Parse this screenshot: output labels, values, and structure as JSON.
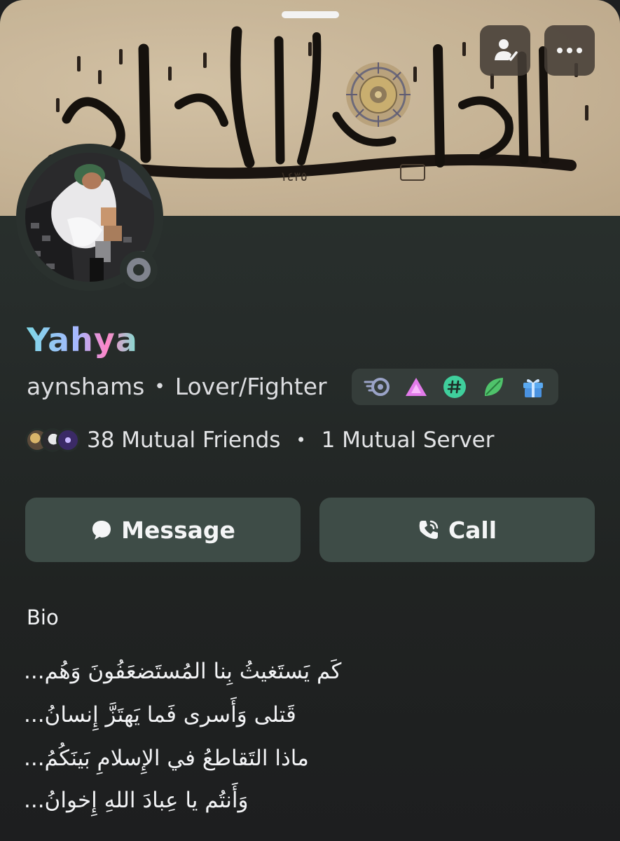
{
  "banner": {
    "calligraphy_text": "ملة أبيكم إبراهيم",
    "year_mark": "١٤٣٥"
  },
  "top_bar": {
    "profile_icon": "person-check-icon",
    "more_icon": "ellipsis-icon"
  },
  "profile": {
    "display_name": "Yahya",
    "username": "aynshams",
    "separator": "•",
    "pronouns": "Lover/Fighter",
    "status": "offline",
    "badges": [
      "nitro-icon",
      "hypesquad-balance-icon",
      "hashtag-icon",
      "leaf-icon",
      "gift-icon"
    ]
  },
  "mutuals": {
    "friends": "38 Mutual Friends",
    "separator": "•",
    "servers": "1 Mutual Server"
  },
  "actions": {
    "message_label": "Message",
    "call_label": "Call"
  },
  "bio": {
    "label": "Bio",
    "lines": [
      "كَم يَستَغيثُ بِنا المُستَضعَفُونَ وَهُم...",
      "قَتلى وَأَسرى فَما يَهتَزَّ إِنسانُ...",
      "ماذا التَقاطعُ في الإِسلامِ بَينَكُمُ...",
      "وَأَنتُم يا عِبادَ اللهِ إِخوانُ..."
    ]
  },
  "colors": {
    "background": "#1e1f20",
    "button": "#3e4c47",
    "banner": "#cbb89b",
    "status_offline": "#80848e"
  }
}
